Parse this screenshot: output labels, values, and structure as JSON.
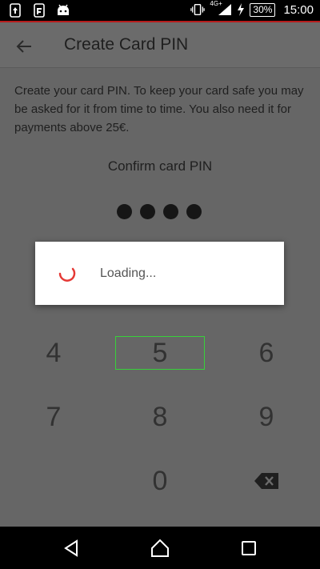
{
  "status_bar": {
    "network": "4G+",
    "battery": "30%",
    "time": "15:00"
  },
  "header": {
    "title": "Create Card PIN"
  },
  "content": {
    "description": "Create your card PIN. To keep your card safe you may be asked for it from time to time. You also need it for payments above 25€.",
    "confirm_label": "Confirm card PIN",
    "pin_filled": 4
  },
  "keypad": {
    "k4": "4",
    "k5": "5",
    "k6": "6",
    "k7": "7",
    "k8": "8",
    "k9": "9",
    "k0": "0"
  },
  "dialog": {
    "loading_text": "Loading..."
  },
  "colors": {
    "accent": "#e53935",
    "focus": "#38d13a"
  }
}
